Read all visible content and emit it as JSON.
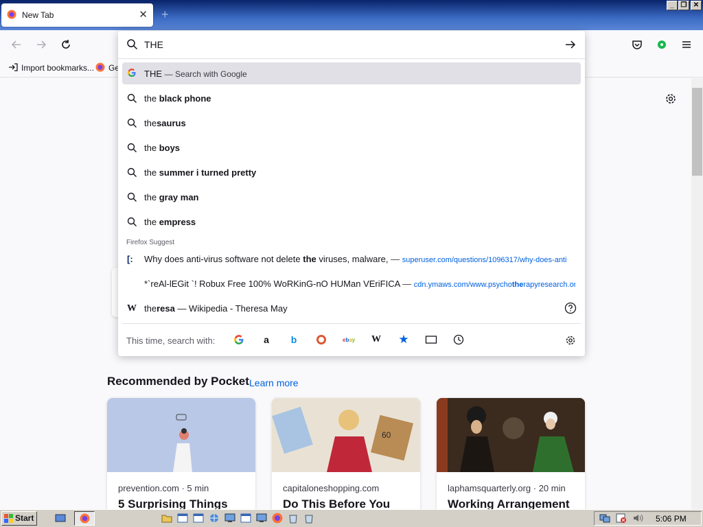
{
  "tab": {
    "title": "New Tab",
    "close": "✕",
    "new": "+"
  },
  "window": {
    "min": "_",
    "restore": "❐",
    "close": "✕"
  },
  "bookmarks": {
    "import": "Import bookmarks...",
    "ge": "Ge"
  },
  "urlbar": {
    "value": "THE"
  },
  "google_row": {
    "text": "THE",
    "suffix": "— Search with Google"
  },
  "suggestions": [
    {
      "prefix": "the ",
      "bold": "black phone"
    },
    {
      "prefix": "the",
      "bold": "saurus"
    },
    {
      "prefix": "the ",
      "bold": "boys"
    },
    {
      "prefix": "the ",
      "bold": "summer i turned pretty"
    },
    {
      "prefix": "the ",
      "bold": "gray man"
    },
    {
      "prefix": "the ",
      "bold": "empress"
    }
  ],
  "firefox_suggest": {
    "label": "Firefox Suggest",
    "items": [
      {
        "pre": "Why does anti-virus software not delete ",
        "bold": "the",
        "post": " viruses, malware,",
        "dash": "—",
        "url": "superuser.com/questions/1096317/why-does-anti"
      },
      {
        "pre": "*`reAl-lEGit `! Robux Free 100% WoRKinG-nO HUMan VEriFICA",
        "bold": "",
        "post": "",
        "dash": "—",
        "url_pre": "cdn.ymaws.com/www.psycho",
        "url_bold": "the",
        "url_post": "rapyresearch.or"
      }
    ],
    "wiki": {
      "prefix": "the",
      "bold": "resa",
      "rest": " — Wikipedia - Theresa May"
    }
  },
  "oneoff": {
    "label": "This time, search with:",
    "engines": [
      "google-icon",
      "amazon-icon",
      "bing-icon",
      "duckduckgo-icon",
      "ebay-icon",
      "wikipedia-icon",
      "bookmarks-icon",
      "tabs-icon",
      "history-icon"
    ]
  },
  "pocket": {
    "title": "Recommended by Pocket",
    "learn_more": "Learn more",
    "cards": [
      {
        "source": "prevention.com · 5 min",
        "headline": "5 Surprising Things"
      },
      {
        "source": "capitaloneshopping.com",
        "headline": "Do This Before You"
      },
      {
        "source": "laphamsquarterly.org · 20 min",
        "headline": "Working Arrangement"
      }
    ]
  },
  "taskbar": {
    "start": "Start",
    "clock": "5:06 PM"
  },
  "colors": {
    "accent": "#0061e0",
    "highlight": "#e0e0e6",
    "titlebar": "#0a246a"
  }
}
